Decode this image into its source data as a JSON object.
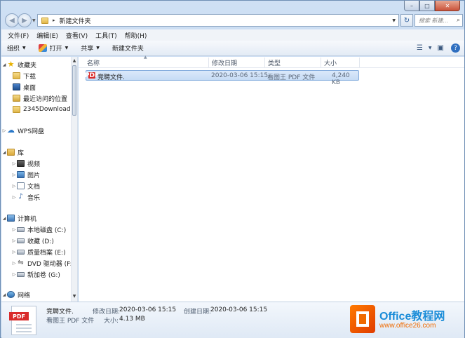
{
  "caption": {
    "min": "–",
    "max": "□",
    "close": "✕"
  },
  "address": {
    "path": "新建文件夹",
    "separator": "▸",
    "search_placeholder": "搜索 新建..."
  },
  "menu": [
    "文件(F)",
    "编辑(E)",
    "查看(V)",
    "工具(T)",
    "帮助(H)"
  ],
  "toolbar": {
    "organize": "组织",
    "open": "打开",
    "share": "共享",
    "new_folder": "新建文件夹"
  },
  "nav": {
    "favorites": "收藏夹",
    "downloads": "下载",
    "desktop": "桌面",
    "recent": "最近访问的位置",
    "download2345": "2345Download",
    "wps": "WPS网盘",
    "libraries": "库",
    "videos": "视频",
    "pictures": "图片",
    "documents": "文档",
    "music": "音乐",
    "computer": "计算机",
    "local_c": "本地磁盘 (C:)",
    "collect_d": "收藏 (D:)",
    "quality_e": "质量档案 (E:)",
    "dvd_f": "DVD 驱动器 (F:)",
    "new_g": "新加卷 (G:)",
    "network": "网络"
  },
  "columns": {
    "name": "名称",
    "modified": "修改日期",
    "type": "类型",
    "size": "大小"
  },
  "file": {
    "name": "竞聘文件.",
    "modified": "2020-03-06 15:15",
    "type": "看图王 PDF 文件",
    "size": "4,240 KB",
    "badge": "PDF"
  },
  "details": {
    "name": "竞聘文件.",
    "type": "看图王 PDF 文件",
    "modified_label": "修改日期:",
    "modified": "2020-03-06 15:15",
    "created_label": "创建日期:",
    "created": "2020-03-06 15:15",
    "size_label": "大小:",
    "size": "4.13 MB",
    "icon_text": "PDF"
  },
  "watermark": {
    "brand": "Office教程网",
    "site": "www.office26.com"
  },
  "colors": {
    "selection": "#c6dcf5",
    "brand_blue": "#1a8cd8",
    "brand_orange": "#f06a00",
    "pdf_red": "#d92b2b"
  }
}
